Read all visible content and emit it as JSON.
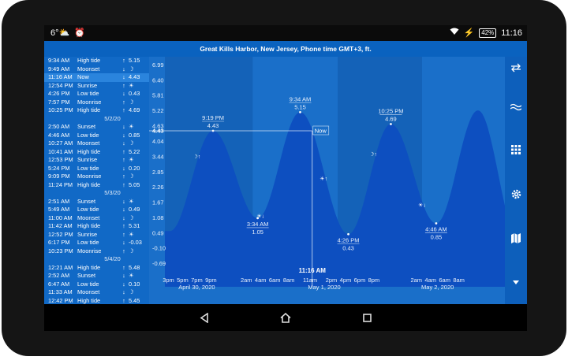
{
  "status": {
    "time": "11:16",
    "battery": "42%"
  },
  "title": "Great Kills Harbor, New Jersey, Phone time GMT+3, ft.",
  "events": [
    {
      "type": "row",
      "time": "9:34 AM",
      "event": "High tide",
      "arrow": "↑",
      "value": "5.15"
    },
    {
      "type": "row",
      "time": "9:49 AM",
      "event": "Moonset",
      "arrow": "↓",
      "value": "☽"
    },
    {
      "type": "row",
      "time": "11:16 AM",
      "event": "Now",
      "arrow": "↓",
      "value": "4.43",
      "selected": true
    },
    {
      "type": "row",
      "time": "12:54 PM",
      "event": "Sunrise",
      "arrow": "↑",
      "value": "☀"
    },
    {
      "type": "row",
      "time": "4:26 PM",
      "event": "Low tide",
      "arrow": "↓",
      "value": "0.43"
    },
    {
      "type": "row",
      "time": "7:57 PM",
      "event": "Moonrise",
      "arrow": "↑",
      "value": "☽"
    },
    {
      "type": "row",
      "time": "10:25 PM",
      "event": "High tide",
      "arrow": "↑",
      "value": "4.69"
    },
    {
      "type": "date",
      "label": "5/2/20"
    },
    {
      "type": "row",
      "time": "2:50 AM",
      "event": "Sunset",
      "arrow": "↓",
      "value": "☀"
    },
    {
      "type": "row",
      "time": "4:46 AM",
      "event": "Low tide",
      "arrow": "↓",
      "value": "0.85"
    },
    {
      "type": "row",
      "time": "10:27 AM",
      "event": "Moonset",
      "arrow": "↓",
      "value": "☽"
    },
    {
      "type": "row",
      "time": "10:41 AM",
      "event": "High tide",
      "arrow": "↑",
      "value": "5.22"
    },
    {
      "type": "row",
      "time": "12:53 PM",
      "event": "Sunrise",
      "arrow": "↑",
      "value": "☀"
    },
    {
      "type": "row",
      "time": "5:24 PM",
      "event": "Low tide",
      "arrow": "↓",
      "value": "0.20"
    },
    {
      "type": "row",
      "time": "9:09 PM",
      "event": "Moonrise",
      "arrow": "↑",
      "value": "☽"
    },
    {
      "type": "row",
      "time": "11:24 PM",
      "event": "High tide",
      "arrow": "↑",
      "value": "5.05"
    },
    {
      "type": "date",
      "label": "5/3/20"
    },
    {
      "type": "row",
      "time": "2:51 AM",
      "event": "Sunset",
      "arrow": "↓",
      "value": "☀"
    },
    {
      "type": "row",
      "time": "5:49 AM",
      "event": "Low tide",
      "arrow": "↓",
      "value": "0.49"
    },
    {
      "type": "row",
      "time": "11:00 AM",
      "event": "Moonset",
      "arrow": "↓",
      "value": "☽"
    },
    {
      "type": "row",
      "time": "11:42 AM",
      "event": "High tide",
      "arrow": "↑",
      "value": "5.31"
    },
    {
      "type": "row",
      "time": "12:52 PM",
      "event": "Sunrise",
      "arrow": "↑",
      "value": "☀"
    },
    {
      "type": "row",
      "time": "6:17 PM",
      "event": "Low tide",
      "arrow": "↓",
      "value": "-0.03"
    },
    {
      "type": "row",
      "time": "10:23 PM",
      "event": "Moonrise",
      "arrow": "↑",
      "value": "☽"
    },
    {
      "type": "date",
      "label": "5/4/20"
    },
    {
      "type": "row",
      "time": "12:21 AM",
      "event": "High tide",
      "arrow": "↑",
      "value": "5.48"
    },
    {
      "type": "row",
      "time": "2:52 AM",
      "event": "Sunset",
      "arrow": "↓",
      "value": "☀"
    },
    {
      "type": "row",
      "time": "6:47 AM",
      "event": "Low tide",
      "arrow": "↓",
      "value": "0.10"
    },
    {
      "type": "row",
      "time": "11:33 AM",
      "event": "Moonset",
      "arrow": "↓",
      "value": "☽"
    },
    {
      "type": "row",
      "time": "12:42 PM",
      "event": "High tide",
      "arrow": "↑",
      "value": "5.45"
    }
  ],
  "chart_data": {
    "type": "area",
    "y_ticks": [
      "6.99",
      "6.40",
      "5.81",
      "5.22",
      "4.63",
      "4.04",
      "3.44",
      "2.85",
      "2.26",
      "1.67",
      "1.08",
      "0.49",
      "-0.10",
      "-0.69"
    ],
    "ylim": [
      -0.69,
      6.99
    ],
    "xlim_hours": [
      14.5,
      62.5
    ],
    "x_start_label": "Apr 30 3pm",
    "x_tick_groups": [
      {
        "ticks": [
          "3pm",
          "5pm",
          "7pm",
          "9pm"
        ],
        "hours": [
          15,
          17,
          19,
          21
        ],
        "date": "April 30, 2020",
        "date_hour": 19
      },
      {
        "ticks": [
          "2am",
          "4am",
          "6am",
          "8am"
        ],
        "hours": [
          26,
          28,
          30,
          32
        ],
        "date": "",
        "date_hour": null
      },
      {
        "ticks": [
          "11am",
          "2pm",
          "4pm",
          "6pm",
          "8pm"
        ],
        "hours": [
          35,
          38,
          40,
          42,
          44
        ],
        "date": "May 1, 2020",
        "date_hour": 37
      },
      {
        "ticks": [
          "2am",
          "4am",
          "6am",
          "8am"
        ],
        "hours": [
          50,
          52,
          54,
          56
        ],
        "date": "May 2, 2020",
        "date_hour": 53
      }
    ],
    "tide_extremes": [
      {
        "hour": 15.2,
        "value": 0.55,
        "label": "",
        "time": ""
      },
      {
        "hour": 21.3,
        "value": 4.43,
        "label": "9:19 PM",
        "time": "9:19 PM"
      },
      {
        "hour": 27.6,
        "value": 1.05,
        "label": "3:34 AM",
        "time": "3:34 AM"
      },
      {
        "hour": 33.6,
        "value": 5.15,
        "label": "9:34 AM",
        "time": "9:34 AM"
      },
      {
        "hour": 40.4,
        "value": 0.43,
        "label": "4:26 PM",
        "time": "4:26 PM"
      },
      {
        "hour": 46.4,
        "value": 4.69,
        "label": "10:25 PM",
        "time": "10:25 PM"
      },
      {
        "hour": 52.8,
        "value": 0.85,
        "label": "4:46 AM",
        "time": "4:46 AM"
      },
      {
        "hour": 58.7,
        "value": 5.22,
        "label": "",
        "time": ""
      },
      {
        "hour": 64.5,
        "value": 0.2,
        "label": "",
        "time": ""
      }
    ],
    "now": {
      "hour": 35.3,
      "value": 4.43,
      "label": "Now",
      "time": "11:16 AM",
      "value_label": "4.43"
    },
    "night_bands_hours": [
      [
        14.5,
        26.9
      ],
      [
        38.9,
        50.8
      ]
    ],
    "markers": [
      {
        "hour": 19.0,
        "value": 3.45,
        "symbol": "☽↑"
      },
      {
        "hour": 28.0,
        "value": 1.15,
        "symbol": "☀↓"
      },
      {
        "hour": 36.9,
        "value": 2.6,
        "symbol": "☀↑"
      },
      {
        "hour": 43.9,
        "value": 3.55,
        "symbol": "☽↑"
      },
      {
        "hour": 50.8,
        "value": 1.58,
        "symbol": "☀↓"
      }
    ],
    "colors": {
      "bg": "#1a6fc9",
      "night": "#1462b8",
      "fill": "#0d4fc0",
      "text": "#e7effb",
      "grid": "#ffffff"
    }
  }
}
